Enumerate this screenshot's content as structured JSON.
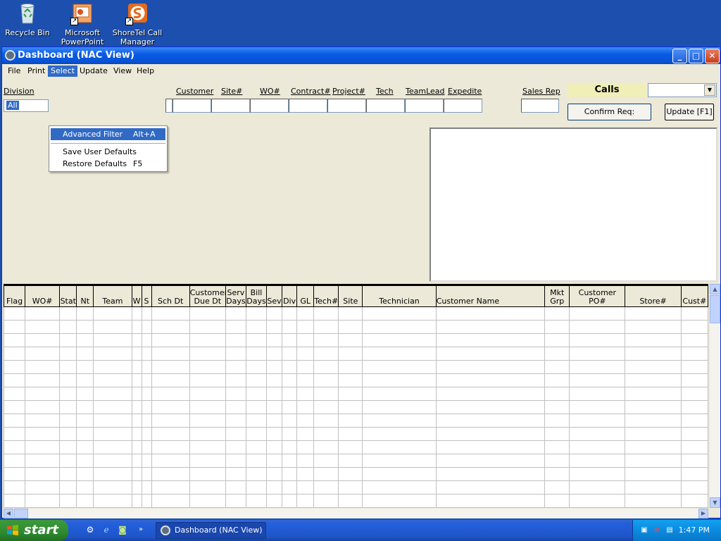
{
  "desktop": {
    "icons": [
      {
        "label": "Recycle Bin"
      },
      {
        "label": "Microsoft PowerPoint"
      },
      {
        "label": "ShoreTel Call Manager"
      }
    ]
  },
  "window": {
    "title": "Dashboard (NAC View)",
    "menu": [
      "File",
      "Print",
      "Select",
      "Update",
      "View",
      "Help"
    ],
    "select_menu": {
      "items": [
        {
          "label": "Advanced Filter",
          "shortcut": "Alt+A"
        },
        {
          "label": "Save User Defaults",
          "shortcut": ""
        },
        {
          "label": "Restore Defaults",
          "shortcut": "F5"
        }
      ]
    },
    "filters": {
      "division_label": "Division",
      "division_value": "All",
      "labels": [
        "Customer",
        "Site#",
        "WO#",
        "Contract#",
        "Project#",
        "Tech",
        "TeamLead",
        "Expedite",
        "Sales Rep"
      ]
    },
    "calls_label": "Calls",
    "buttons": {
      "confirm": "Confirm Req:",
      "update": "Update [F1]"
    },
    "grid": {
      "columns": [
        "Flag",
        "WO#",
        "Stat",
        "Nt",
        "Team",
        "W",
        "S",
        "Sch Dt",
        "Customer\nDue Dt",
        "Serv\nDays",
        "Bill\nDays",
        "Sev",
        "Div",
        "GL",
        "Tech#",
        "Site",
        "Technician",
        "Customer Name",
        "Mkt\nGrp",
        "Customer\nPO#",
        "Store#",
        "Cust#"
      ]
    }
  },
  "taskbar": {
    "start_label": "start",
    "task_label": "Dashboard (NAC View)",
    "clock": "1:47 PM"
  }
}
